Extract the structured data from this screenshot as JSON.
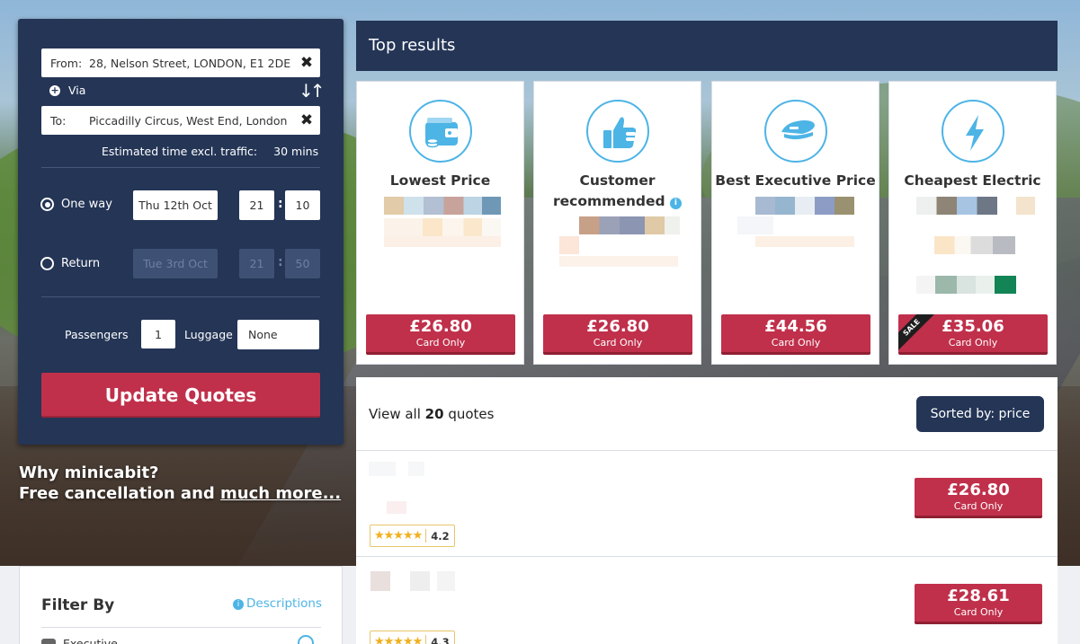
{
  "search": {
    "from_label": "From:",
    "from_value": "28, Nelson Street, LONDON, E1 2DE",
    "via_label": "Via",
    "to_label": "To:",
    "to_value": "Piccadilly Circus, West End, London",
    "est_label": "Estimated time excl. traffic:",
    "est_value": "30 mins",
    "one_way_label": "One way",
    "one_way_date": "Thu 12th Oct",
    "one_way_hour": "21",
    "one_way_min": "10",
    "return_label": "Return",
    "return_date": "Tue 3rd Oct",
    "return_hour": "21",
    "return_min": "50",
    "time_sep": ":",
    "passengers_label": "Passengers",
    "passengers_value": "1",
    "luggage_label": "Luggage",
    "luggage_value": "None",
    "update_button": "Update Quotes"
  },
  "promo": {
    "line1": "Why minicabit?",
    "line2": "Free cancellation and ",
    "link": "much more..."
  },
  "top_results": {
    "header": "Top results",
    "cards": [
      {
        "title": "Lowest Price",
        "price": "£26.80",
        "sub": "Card Only",
        "icon": "wallet-icon"
      },
      {
        "title": "Customer recommended",
        "price": "£26.80",
        "sub": "Card Only",
        "icon": "thumbs-up-icon"
      },
      {
        "title": "Best Executive Price",
        "price": "£44.56",
        "sub": "Card Only",
        "icon": "chauffeur-cap-icon"
      },
      {
        "title": "Cheapest Electric",
        "price": "£35.06",
        "sub": "Card Only",
        "icon": "lightning-icon",
        "badge": "SALE"
      }
    ]
  },
  "quotes": {
    "count_prefix": "View all ",
    "count": "20",
    "count_suffix": " quotes",
    "sort_label": "Sorted by: price",
    "rows": [
      {
        "price": "£26.80",
        "sub": "Card Only",
        "rating": "4.2",
        "stars": "★★★★★"
      },
      {
        "price": "£28.61",
        "sub": "Card Only",
        "rating": "4.3",
        "stars": "★★★★★"
      }
    ]
  },
  "filter": {
    "title": "Filter By",
    "descriptions": "Descriptions",
    "first_option": "Executive"
  },
  "colors": {
    "navy": "#243556",
    "accent_red": "#c0304b",
    "accent_blue": "#4db4e6",
    "star_gold": "#f2b01e"
  }
}
